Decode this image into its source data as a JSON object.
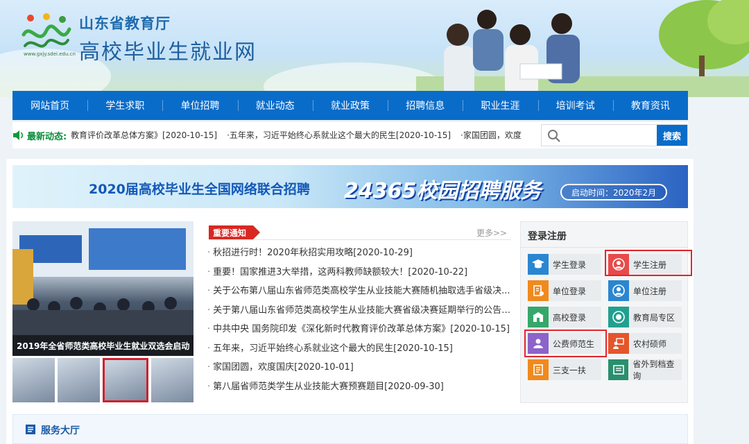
{
  "header": {
    "org": "山东省教育厅",
    "title": "高校毕业生就业网",
    "logo_url": "www.gxjy.sdei.edu.cn"
  },
  "nav": [
    "网站首页",
    "学生求职",
    "单位招聘",
    "就业动态",
    "就业政策",
    "招聘信息",
    "职业生涯",
    "培训考试",
    "教育资讯"
  ],
  "newsbar": {
    "label": "最新动态:",
    "items": [
      "教育评价改革总体方案》[2020-10-15]",
      "·五年来，习近平始终心系就业这个最大的民生[2020-10-15]",
      "·家国团圆，欢度"
    ]
  },
  "search": {
    "placeholder": "",
    "button": "搜索"
  },
  "banner": {
    "text1": "2020届高校毕业生全国网络联合招聘",
    "text2": "24365校园招聘服务",
    "date": "启动时间：2020年2月"
  },
  "slide": {
    "caption": "2019年全省师范类高校毕业生就业双选会启动"
  },
  "notices": {
    "tag": "重要通知",
    "more": "更多>>",
    "items": [
      "秋招进行时！2020年秋招实用攻略[2020-10-29]",
      "重要！国家推进3大举措，这两科教师缺额较大！[2020-10-22]",
      "关于公布第八届山东省师范类高校学生从业技能大赛随机抽取选手省级决...",
      "关于第八届山东省师范类高校学生从业技能大赛省级决赛延期举行的公告[...",
      "中共中央 国务院印发《深化新时代教育评价改革总体方案》[2020-10-15]",
      "五年来，习近平始终心系就业这个最大的民生[2020-10-15]",
      "家国团圆，欢度国庆[2020-10-01]",
      "第八届省师范类学生从业技能大赛预赛题目[2020-09-30]"
    ]
  },
  "login": {
    "title": "登录注册",
    "buttons": [
      {
        "label": "学生登录",
        "icon": "graduation-cap-icon",
        "color": "#2a86d1"
      },
      {
        "label": "学生注册",
        "icon": "user-icon",
        "color": "#e84a4a"
      },
      {
        "label": "单位登录",
        "icon": "building-doc-icon",
        "color": "#f08a1e"
      },
      {
        "label": "单位注册",
        "icon": "user-circle-icon",
        "color": "#2a86d1"
      },
      {
        "label": "高校登录",
        "icon": "school-icon",
        "color": "#35a76a"
      },
      {
        "label": "教育局专区",
        "icon": "emblem-icon",
        "color": "#21a08f"
      },
      {
        "label": "公费师范生",
        "icon": "teacher-icon",
        "color": "#8c63c9"
      },
      {
        "label": "农村硕师",
        "icon": "lecture-icon",
        "color": "#e5552a"
      },
      {
        "label": "三支一扶",
        "icon": "document-icon",
        "color": "#f08a1e"
      },
      {
        "label": "省外到档查询",
        "icon": "list-icon",
        "color": "#2a8f6d"
      }
    ]
  },
  "service": {
    "title": "服务大厅"
  }
}
